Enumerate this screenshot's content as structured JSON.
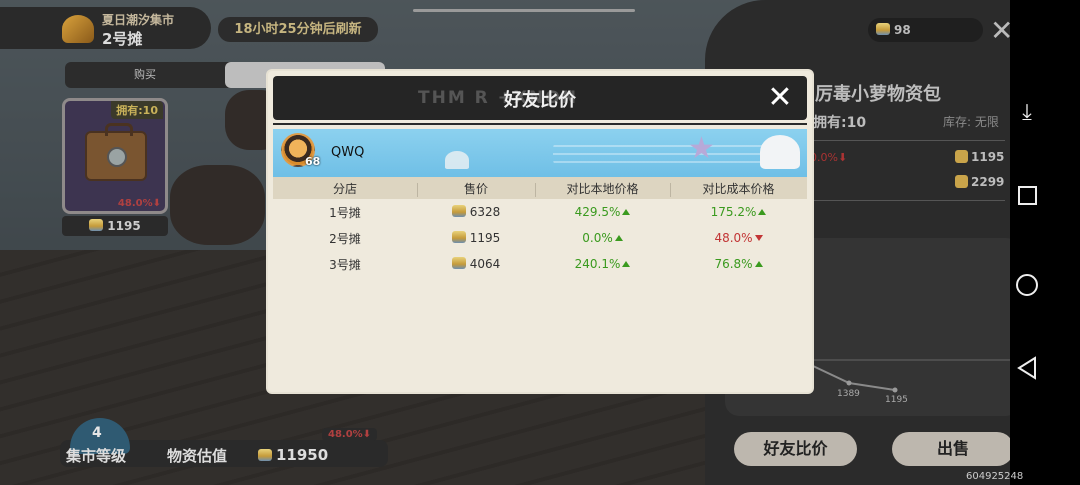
{
  "market": {
    "name": "夏日潮汐集市",
    "stall": "2号摊",
    "refresh_text": "18小时25分钟后刷新"
  },
  "tabs": [
    {
      "label": "购买",
      "active": false
    },
    {
      "label": "",
      "active": true
    }
  ],
  "item": {
    "own_badge": "拥有:10",
    "change_pct": "48.0%",
    "price": "1195"
  },
  "bottom": {
    "level": "4",
    "level_label": "集市等级",
    "value_label": "物资估值",
    "value": "11950",
    "value_pct": "48.0%"
  },
  "top_right": {
    "coins": "98"
  },
  "right_panel": {
    "title": "厉毒小萝物资包",
    "own": "拥有:10",
    "stock": "库存: 无限",
    "pct": "0.0%",
    "price_a": "1195",
    "price_b": "2299",
    "chart_labels": [
      "1389",
      "1195"
    ],
    "friend_compare_button": "好友比价",
    "sell_button": "出售"
  },
  "modal": {
    "title": "好友比价",
    "ghost_title": "THM R  +XNON",
    "friend": {
      "name": "QWQ",
      "level": "68"
    },
    "columns": [
      "分店",
      "售价",
      "对比本地价格",
      "对比成本价格"
    ],
    "rows": [
      {
        "store": "1号摊",
        "price": "6328",
        "local_pct": "429.5%",
        "local_dir": "up",
        "cost_pct": "175.2%",
        "cost_dir": "up"
      },
      {
        "store": "2号摊",
        "price": "1195",
        "local_pct": "0.0%",
        "local_dir": "up",
        "cost_pct": "48.0%",
        "cost_dir": "down"
      },
      {
        "store": "3号摊",
        "price": "4064",
        "local_pct": "240.1%",
        "local_dir": "up",
        "cost_pct": "76.8%",
        "cost_dir": "up"
      }
    ]
  },
  "watermark": "604925248",
  "colors": {
    "up": "#3a9a1e",
    "down": "#c23535",
    "header": "#252525",
    "panel": "#efeadd"
  }
}
